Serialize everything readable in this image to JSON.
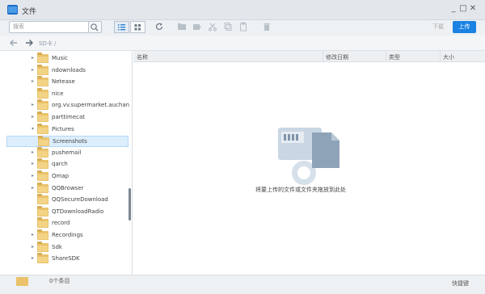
{
  "window": {
    "title": "文件"
  },
  "window_controls": {
    "minimize": "_",
    "maximize": "□",
    "close": "✕"
  },
  "toolbar": {
    "search_placeholder": "搜索",
    "download_label": "下载",
    "upload_label": "上传"
  },
  "path": {
    "crumb": "SD卡 /"
  },
  "tree": [
    {
      "label": "Music",
      "expandable": true
    },
    {
      "label": "ndownloads",
      "expandable": true
    },
    {
      "label": "Netease",
      "expandable": true
    },
    {
      "label": "nice",
      "expandable": false
    },
    {
      "label": "org.vv.supermarket.auchan",
      "expandable": true
    },
    {
      "label": "parttimecat",
      "expandable": true
    },
    {
      "label": "Pictures",
      "expandable": true,
      "expanded": true
    },
    {
      "label": "Screenshots",
      "expandable": false,
      "selected": true,
      "child": true
    },
    {
      "label": "pushemail",
      "expandable": true
    },
    {
      "label": "qarch",
      "expandable": true
    },
    {
      "label": "Qmap",
      "expandable": true
    },
    {
      "label": "QQBrowser",
      "expandable": true
    },
    {
      "label": "QQSecureDownload",
      "expandable": false
    },
    {
      "label": "QTDownloadRadio",
      "expandable": false
    },
    {
      "label": "record",
      "expandable": false
    },
    {
      "label": "Recordings",
      "expandable": true
    },
    {
      "label": "Sdk",
      "expandable": true
    },
    {
      "label": "ShareSDK",
      "expandable": true
    }
  ],
  "columns": {
    "name": "名称",
    "modified": "修改日期",
    "type": "类型",
    "size": "大小"
  },
  "empty_message": "将要上传的文件或文件夹拖放到此处",
  "status": {
    "count": "0个条目",
    "shortcut": "快捷键"
  },
  "colors": {
    "accent": "#1a82e2",
    "folder": "#e9c26b",
    "selection": "#dceefc"
  }
}
